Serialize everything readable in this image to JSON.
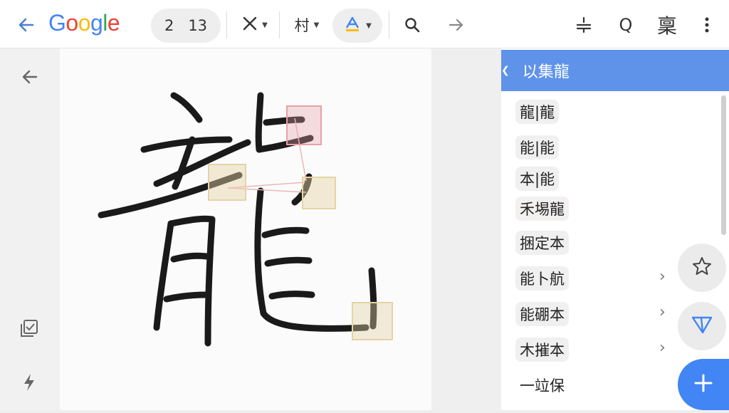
{
  "topbar": {
    "logo": "Google",
    "page_current": "2",
    "page_total": "13",
    "tool_close_icon": "x-icon",
    "tool_stroke_label": "村",
    "tool_font_icon": "text-color-icon",
    "right_label_q": "Q",
    "right_label_char": "稟"
  },
  "panel": {
    "header_text": "以集龍",
    "suggestions": [
      {
        "text": "龍|龍",
        "chev": ""
      },
      {
        "text": "能|能",
        "chev": ""
      },
      {
        "text": "本|能",
        "chev": ""
      },
      {
        "text": "禾埸龍",
        "chev": ""
      },
      {
        "text": "捆定本",
        "chev": ""
      },
      {
        "text": "能卜航",
        "chev": "›"
      },
      {
        "text": "能硼本",
        "chev": "›"
      },
      {
        "text": "木摧本",
        "chev": "›"
      },
      {
        "text": "一竝保",
        "chev": ""
      }
    ]
  },
  "colors": {
    "accent": "#5f93ea",
    "fab_blue": "#4285f4",
    "highlight_red": "#e8a0a8",
    "highlight_tan": "#e6d3a6"
  }
}
